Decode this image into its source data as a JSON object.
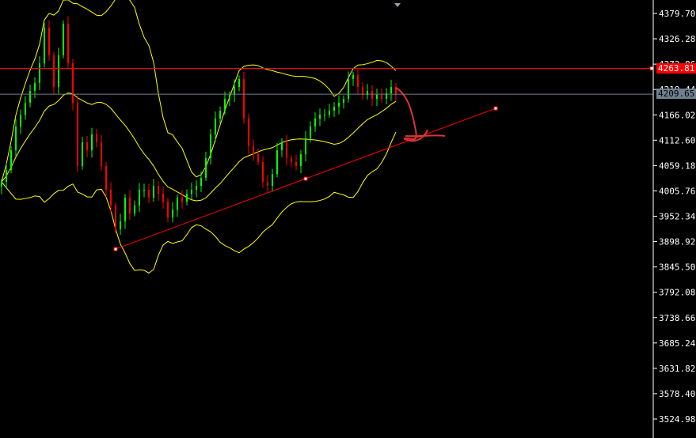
{
  "chart_data": {
    "type": "candlestick",
    "title": "",
    "y_ticks": [
      "4379.70",
      "4326.28",
      "4272.86",
      "4219.44",
      "4166.02",
      "4112.60",
      "4059.18",
      "4005.76",
      "3952.34",
      "3898.92",
      "3845.50",
      "3792.08",
      "3738.66",
      "3685.24",
      "3631.82",
      "3578.40",
      "3524.98"
    ],
    "ylim": [
      3524.98,
      4379.7
    ],
    "closes": [
      4024.8,
      4049.8,
      4091.4,
      4141.4,
      4166.4,
      4191.4,
      4216.4,
      4233.1,
      4274.7,
      4349.7,
      4291.4,
      4224.7,
      4291.4,
      4358.0,
      4274.7,
      4191.4,
      4058.1,
      4108.1,
      4091.4,
      4124.7,
      4108.1,
      4058.1,
      4008.1,
      3974.8,
      3924.8,
      3941.5,
      3991.5,
      3958.1,
      3974.8,
      4008.1,
      4008.1,
      3991.5,
      4016.4,
      3999.8,
      3983.1,
      3949.8,
      3966.4,
      3991.5,
      3983.1,
      3999.8,
      4008.1,
      4016.4,
      4033.1,
      4074.8,
      4124.7,
      4158.1,
      4174.7,
      4199.7,
      4208.1,
      4224.7,
      4241.4,
      4158.1,
      4099.8,
      4083.1,
      4066.4,
      4024.8,
      4016.4,
      4041.4,
      4091.4,
      4108.1,
      4074.8,
      4066.4,
      4058.1,
      4083.1,
      4116.4,
      4141.4,
      4158.1,
      4166.4,
      4166.4,
      4174.7,
      4183.1,
      4191.4,
      4199.7,
      4241.4,
      4249.7,
      4224.7,
      4208.1,
      4216.4,
      4199.7,
      4208.1,
      4199.7,
      4211.4,
      4224.7,
      4208.1
    ],
    "bollinger": {
      "period": 20,
      "deviations": 2
    },
    "horizontal_lines": [
      {
        "price": 4263.81,
        "label": "4263.81",
        "color": "#ff0000"
      },
      {
        "price": 4209.65,
        "label": "4209.65",
        "color": "#708090"
      }
    ],
    "trendline": {
      "start_bar": 24,
      "start_price": 3883.1,
      "mid_bar": 64,
      "end_bar": 104,
      "end_price": 4179.7,
      "color": "#ff0000"
    },
    "colors": {
      "up": "#00ff00",
      "down": "#ff0000",
      "bands": "#ffff00",
      "axis": "#ffffff",
      "background": "#000000"
    }
  }
}
